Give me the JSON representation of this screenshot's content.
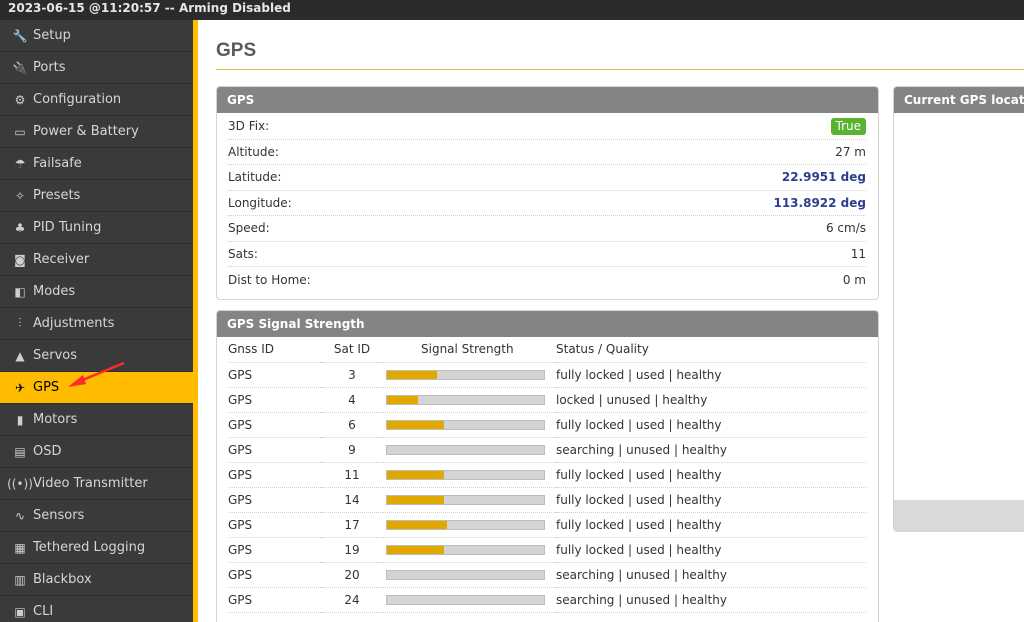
{
  "topbar": {
    "status": "2023-06-15 @11:20:57 -- Arming Disabled"
  },
  "sidebar": {
    "items": [
      {
        "label": "Setup",
        "icon": "wrench-icon",
        "glyph": "🔧"
      },
      {
        "label": "Ports",
        "icon": "plug-icon",
        "glyph": "🔌"
      },
      {
        "label": "Configuration",
        "icon": "gear-icon",
        "glyph": "⚙"
      },
      {
        "label": "Power & Battery",
        "icon": "battery-icon",
        "glyph": "▭"
      },
      {
        "label": "Failsafe",
        "icon": "parachute-icon",
        "glyph": "☂"
      },
      {
        "label": "Presets",
        "icon": "magic-wand-icon",
        "glyph": "✧"
      },
      {
        "label": "PID Tuning",
        "icon": "sitemap-icon",
        "glyph": "♣"
      },
      {
        "label": "Receiver",
        "icon": "robot-icon",
        "glyph": "◙"
      },
      {
        "label": "Modes",
        "icon": "toggle-icon",
        "glyph": "◧"
      },
      {
        "label": "Adjustments",
        "icon": "sliders-icon",
        "glyph": "⫶"
      },
      {
        "label": "Servos",
        "icon": "servo-icon",
        "glyph": "▲"
      },
      {
        "label": "GPS",
        "icon": "satellite-icon",
        "glyph": "✈",
        "active": true
      },
      {
        "label": "Motors",
        "icon": "motor-icon",
        "glyph": "▮"
      },
      {
        "label": "OSD",
        "icon": "osd-icon",
        "glyph": "▤"
      },
      {
        "label": "Video Transmitter",
        "icon": "broadcast-icon",
        "glyph": "((•))"
      },
      {
        "label": "Sensors",
        "icon": "pulse-icon",
        "glyph": "∿"
      },
      {
        "label": "Tethered Logging",
        "icon": "keyboard-icon",
        "glyph": "▦"
      },
      {
        "label": "Blackbox",
        "icon": "barcode-icon",
        "glyph": "▥"
      },
      {
        "label": "CLI",
        "icon": "terminal-icon",
        "glyph": "▣"
      }
    ]
  },
  "page": {
    "title": "GPS"
  },
  "gps_panel": {
    "title": "GPS",
    "rows": [
      {
        "label": "3D Fix:",
        "value": "True",
        "type": "badge"
      },
      {
        "label": "Altitude:",
        "value": "27 m"
      },
      {
        "label": "Latitude:",
        "value": "22.9951 deg",
        "type": "coord"
      },
      {
        "label": "Longitude:",
        "value": "113.8922 deg",
        "type": "coord"
      },
      {
        "label": "Speed:",
        "value": "6 cm/s"
      },
      {
        "label": "Sats:",
        "value": "11"
      },
      {
        "label": "Dist to Home:",
        "value": "0 m"
      }
    ]
  },
  "signal_panel": {
    "title": "GPS Signal Strength",
    "headers": [
      "Gnss ID",
      "Sat ID",
      "Signal Strength",
      "Status / Quality"
    ],
    "rows": [
      {
        "gnss": "GPS",
        "sat": "3",
        "strength": 0.32,
        "status": "fully locked | used | healthy"
      },
      {
        "gnss": "GPS",
        "sat": "4",
        "strength": 0.2,
        "status": "locked | unused | healthy"
      },
      {
        "gnss": "GPS",
        "sat": "6",
        "strength": 0.36,
        "status": "fully locked | used | healthy"
      },
      {
        "gnss": "GPS",
        "sat": "9",
        "strength": 0.0,
        "status": "searching | unused | healthy"
      },
      {
        "gnss": "GPS",
        "sat": "11",
        "strength": 0.36,
        "status": "fully locked | used | healthy"
      },
      {
        "gnss": "GPS",
        "sat": "14",
        "strength": 0.36,
        "status": "fully locked | used | healthy"
      },
      {
        "gnss": "GPS",
        "sat": "17",
        "strength": 0.38,
        "status": "fully locked | used | healthy"
      },
      {
        "gnss": "GPS",
        "sat": "19",
        "strength": 0.36,
        "status": "fully locked | used | healthy"
      },
      {
        "gnss": "GPS",
        "sat": "20",
        "strength": 0.0,
        "status": "searching | unused | healthy"
      },
      {
        "gnss": "GPS",
        "sat": "24",
        "strength": 0.0,
        "status": "searching | unused | healthy"
      }
    ]
  },
  "map_panel": {
    "title": "Current GPS location"
  },
  "colors": {
    "accent": "#ffbb00",
    "sidebar_bg": "#3a3a3a",
    "panel_header": "#828583",
    "fix_badge": "#58b32e",
    "coord_text": "#2c3f8f",
    "bar_fill": "#e0a800",
    "annotation_arrow": "#ff2a2a"
  }
}
